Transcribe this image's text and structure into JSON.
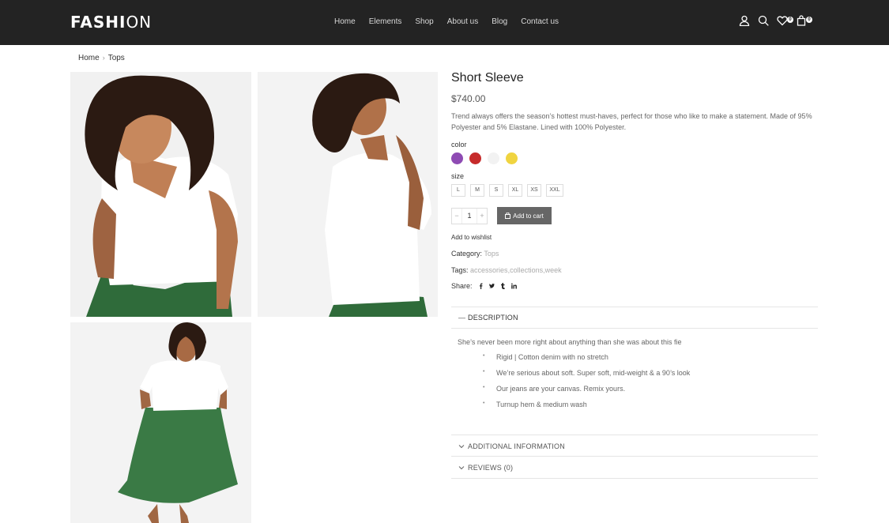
{
  "header": {
    "logo_bold": "FASHI",
    "logo_light": "ON",
    "nav": [
      "Home",
      "Elements",
      "Shop",
      "About us",
      "Blog",
      "Contact us"
    ],
    "icons": [
      "user-icon",
      "search-icon",
      "heart-icon",
      "bag-icon"
    ],
    "wishlist_count": "0",
    "cart_count": "0"
  },
  "breadcrumb": {
    "home": "Home",
    "separator": "›",
    "current": "Tops"
  },
  "product": {
    "title": "Short Sleeve",
    "price": "$740.00",
    "description": "Trend always offers the season’s hottest must-haves, perfect for those who like to make a statement. Made of 95% Polyester and 5% Elastane. Lined with 100% Polyester.",
    "color_label": "color",
    "colors": [
      "#8e4bb3",
      "#c62b2b",
      "#f2f2f2",
      "#f0d440"
    ],
    "size_label": "size",
    "sizes": [
      "L",
      "M",
      "S",
      "XL",
      "XS",
      "XXL"
    ],
    "qty_minus": "−",
    "quantity": "1",
    "qty_plus": "+",
    "add_to_cart": "Add to cart",
    "add_to_wishlist": "Add to wishlist",
    "category_label": "Category:",
    "category": "Tops",
    "tags_label": "Tags:",
    "tags": [
      "accessories",
      "collections",
      "week"
    ],
    "share_label": "Share:"
  },
  "tabs": {
    "description": {
      "title": "DESCRIPTION",
      "intro": "She’s never been more right about anything than she was about this fie",
      "bullets": [
        "Rigid | Cotton denim with no stretch",
        "We’re serious about soft. Super soft, mid-weight & a 90’s look",
        "Our jeans are your canvas. Remix yours.",
        "Turnup hem & medium wash"
      ]
    },
    "additional": {
      "title": "ADDITIONAL INFORMATION"
    },
    "reviews": {
      "title": "REVIEWS (0)"
    }
  }
}
